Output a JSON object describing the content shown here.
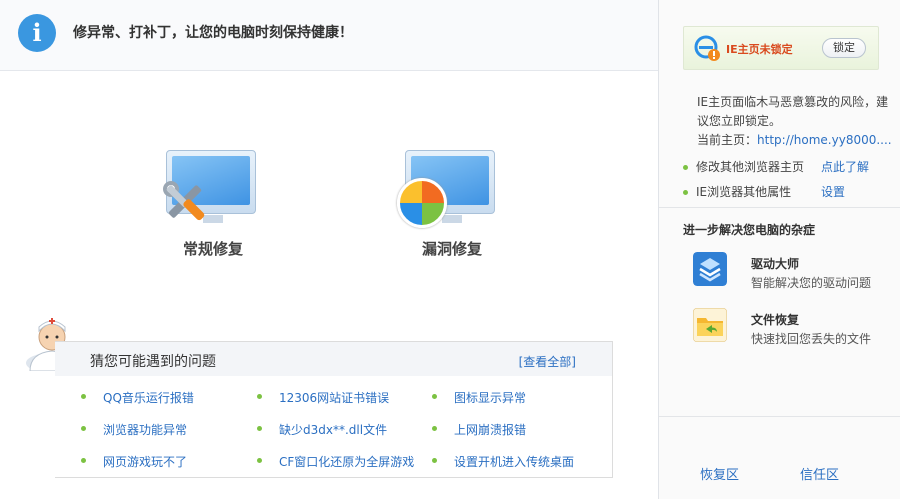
{
  "header": {
    "title": "修异常、打补丁，让您的电脑时刻保持健康！"
  },
  "repair": {
    "regular_label": "常规修复",
    "vuln_label": "漏洞修复"
  },
  "problems": {
    "title": "猜您可能遇到的问题",
    "view_all": "[查看全部]",
    "items": [
      "QQ音乐运行报错",
      "12306网站证书错误",
      "图标显示异常",
      "浏览器功能异常",
      "缺少d3dx**.dll文件",
      "上网崩溃报错",
      "网页游戏玩不了",
      "CF窗口化还原为全屏游戏",
      "设置开机进入传统桌面"
    ]
  },
  "sidebar": {
    "ie_status": "IE主页未锁定",
    "lock_button": "锁定",
    "risk_text": "IE主页面临木马恶意篡改的风险，建议您立即锁定。",
    "homepage_label": "当前主页：",
    "homepage_url": "http://home.yy8000....",
    "options": [
      {
        "label": "修改其他浏览器主页",
        "link": "点此了解"
      },
      {
        "label": "IE浏览器其他属性",
        "link": "设置"
      }
    ],
    "further_title": "进一步解决您电脑的杂症",
    "tools": [
      {
        "name": "驱动大师",
        "desc": "智能解决您的驱动问题"
      },
      {
        "name": "文件恢复",
        "desc": "快速找回您丢失的文件"
      }
    ],
    "footer": {
      "restore": "恢复区",
      "trust": "信任区"
    }
  },
  "colors": {
    "accent_blue": "#3a97e0",
    "link_blue": "#2b6fc2",
    "bullet_green": "#7cc242",
    "warning_orange": "#d94a1e"
  }
}
